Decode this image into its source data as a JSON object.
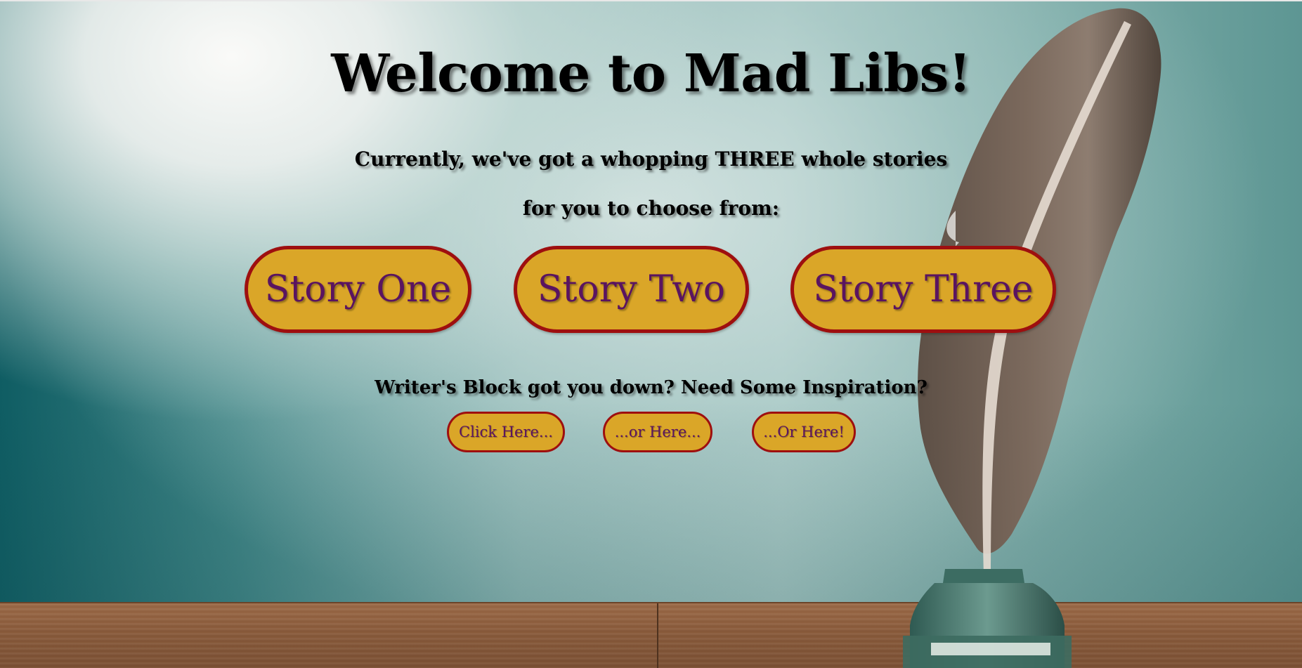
{
  "page": {
    "title": "Welcome to Mad Libs!",
    "subtitle_line1": "Currently, we've got a whopping THREE whole stories",
    "subtitle_line2": "for you to choose from:"
  },
  "stories": {
    "story_one": "Story One",
    "story_two": "Story Two",
    "story_three": "Story Three"
  },
  "inspiration": {
    "prompt": "Writer's Block got you down? Need Some Inspiration?",
    "link_one": "Click Here...",
    "link_two": "...or Here...",
    "link_three": "...Or Here!"
  },
  "colors": {
    "button_fill": "#daa628",
    "button_border": "#9e0f0f",
    "button_text": "#5a1460"
  }
}
